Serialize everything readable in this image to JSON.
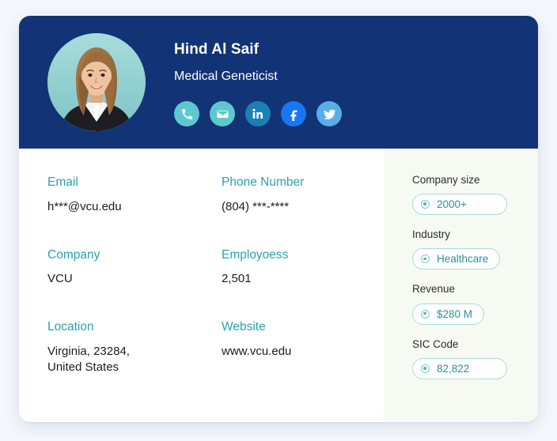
{
  "profile": {
    "name": "Hind Al Saif",
    "title": "Medical Geneticist",
    "avatar_icon": "person-photo",
    "socials": [
      {
        "name": "phone",
        "icon": "phone-icon",
        "color": "#5ec8cf"
      },
      {
        "name": "email",
        "icon": "envelope-icon",
        "color": "#5ec8cf"
      },
      {
        "name": "linkedin",
        "icon": "linkedin-icon",
        "color": "#1b7fb8"
      },
      {
        "name": "facebook",
        "icon": "facebook-icon",
        "color": "#1877f2"
      },
      {
        "name": "twitter",
        "icon": "twitter-icon",
        "color": "#5aaee8"
      }
    ]
  },
  "details": {
    "email": {
      "label": "Email",
      "value": "h***@vcu.edu"
    },
    "phone": {
      "label": "Phone Number",
      "value": "(804) ***-****"
    },
    "company": {
      "label": "Company",
      "value": "VCU"
    },
    "employees": {
      "label": "Employoess",
      "value": "2,501"
    },
    "location": {
      "label": "Location",
      "value": "Virginia, 23284,\nUnited States"
    },
    "website": {
      "label": "Website",
      "value": "www.vcu.edu"
    }
  },
  "side_panel": {
    "items": [
      {
        "label": "Company size",
        "value": "2000+",
        "wide": true
      },
      {
        "label": "Industry",
        "value": "Healthcare",
        "wide": false
      },
      {
        "label": "Revenue",
        "value": "$280 M",
        "wide": false
      },
      {
        "label": "SIC Code",
        "value": "82,822",
        "wide": true
      }
    ]
  },
  "colors": {
    "header_navy": "#123476",
    "label_teal": "#29a3b0",
    "pill_teal": "#2b8f9c",
    "pill_border": "#a9dbdb",
    "page_bg": "#f4f7fb",
    "side_bg": "#f7faf2"
  }
}
